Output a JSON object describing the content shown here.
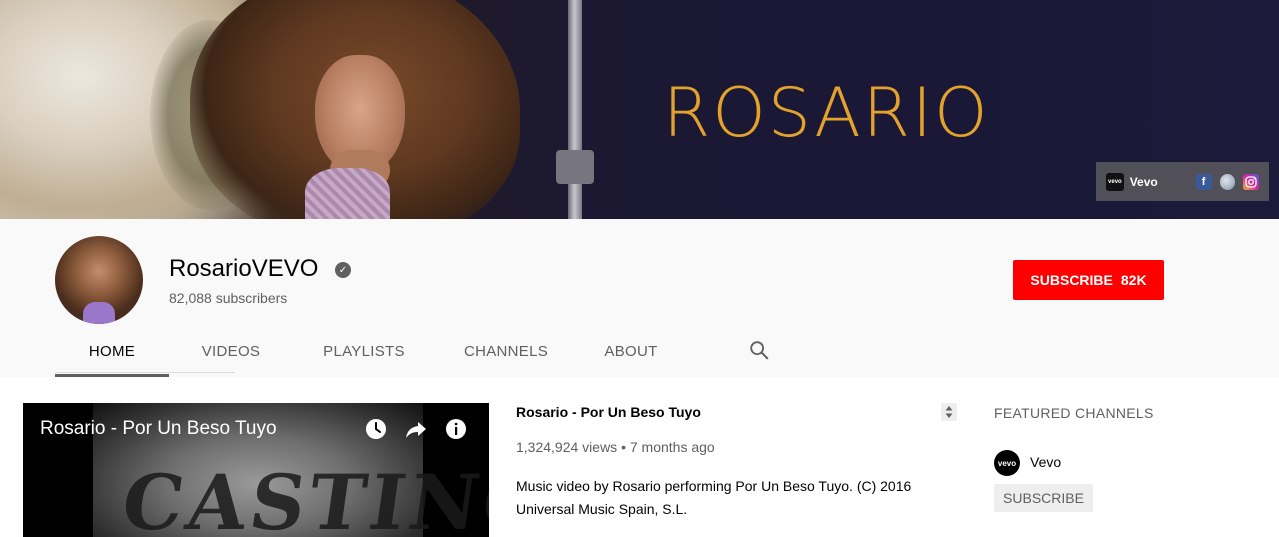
{
  "banner": {
    "title": "ROSARIO",
    "links": {
      "vevo_label": "Vevo",
      "vevo_mark": "vevo",
      "facebook_glyph": "f"
    }
  },
  "channel": {
    "name": "RosarioVEVO",
    "subscribers": "82,088 subscribers",
    "subscribe_label": "SUBSCRIBE",
    "subscribe_count": "82K"
  },
  "tabs": [
    {
      "label": "HOME",
      "active": true
    },
    {
      "label": "VIDEOS",
      "active": false
    },
    {
      "label": "PLAYLISTS",
      "active": false
    },
    {
      "label": "CHANNELS",
      "active": false
    },
    {
      "label": "ABOUT",
      "active": false
    }
  ],
  "featured_video": {
    "overlay_title": "Rosario - Por Un Beso Tuyo",
    "frame_text": "CASTING",
    "title": "Rosario - Por Un Beso Tuyo",
    "meta": "1,324,924 views • 7 months ago",
    "description": "Music video by Rosario performing Por Un Beso Tuyo. (C) 2016 Universal Music Spain, S.L."
  },
  "featured_channels": {
    "heading": "FEATURED CHANNELS",
    "items": [
      {
        "name": "Vevo",
        "avatar_text": "vevo",
        "subscribe_label": "SUBSCRIBE"
      }
    ]
  },
  "colors": {
    "accent": "#ff0000",
    "banner_title": "#e3a22b",
    "text_secondary": "#606060"
  },
  "icons": [
    "verified-check-icon",
    "search-icon",
    "watch-later-icon",
    "share-icon",
    "info-icon",
    "sort-icon",
    "facebook-icon",
    "globe-icon",
    "instagram-icon"
  ]
}
